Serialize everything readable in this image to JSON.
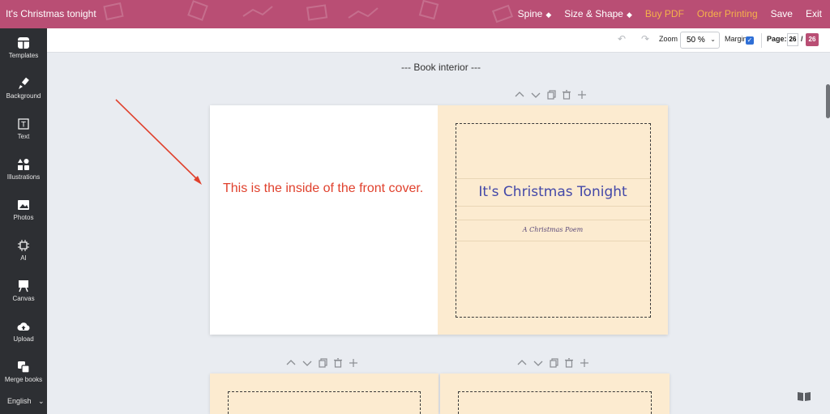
{
  "app": {
    "title": "It's Christmas tonight"
  },
  "topnav": {
    "spine": "Spine",
    "size_shape": "Size & Shape",
    "buy_pdf": "Buy PDF",
    "order_printing": "Order Printing",
    "save": "Save",
    "exit": "Exit"
  },
  "sidebar": {
    "items": [
      {
        "label": "Templates",
        "icon": "templates-icon"
      },
      {
        "label": "Background",
        "icon": "paint-brush-icon"
      },
      {
        "label": "Text",
        "icon": "text-icon"
      },
      {
        "label": "Illustrations",
        "icon": "shapes-icon"
      },
      {
        "label": "Photos",
        "icon": "image-icon"
      },
      {
        "label": "AI",
        "icon": "ai-chip-icon"
      },
      {
        "label": "Canvas",
        "icon": "easel-icon"
      },
      {
        "label": "Upload",
        "icon": "cloud-upload-icon"
      },
      {
        "label": "Merge books",
        "icon": "merge-icon"
      }
    ],
    "language": "English"
  },
  "toolbar": {
    "zoom_label": "Zoom",
    "zoom_value": "50 %",
    "margin_label": "Margin",
    "margin_checked": true,
    "page_label": "Page:",
    "page_current": "26",
    "page_separator": "/",
    "page_total": "26"
  },
  "canvas": {
    "section_label": "--- Book interior ---",
    "inside_note": "This is the inside of the front cover.",
    "cover": {
      "title": "It's Christmas Tonight",
      "subtitle": "A Christmas Poem"
    }
  },
  "colors": {
    "brand": "#b94e74",
    "accent_orange": "#f6b24a",
    "cover_bg": "#fcebd0",
    "title_blue": "#4348a8",
    "annotation_red": "#e0412d"
  }
}
